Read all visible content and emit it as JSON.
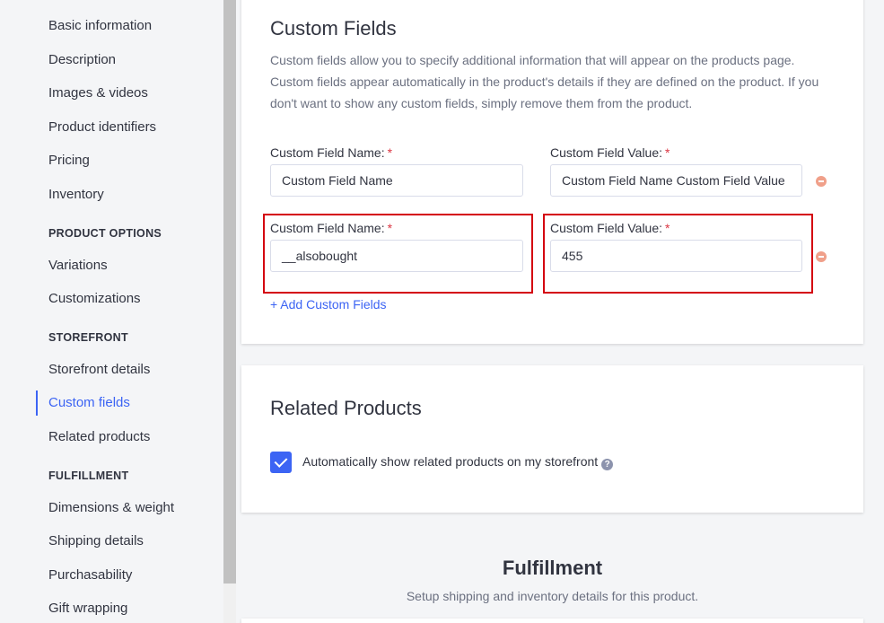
{
  "sidebar": {
    "items": [
      {
        "label": "Basic information"
      },
      {
        "label": "Description"
      },
      {
        "label": "Images & videos"
      },
      {
        "label": "Product identifiers"
      },
      {
        "label": "Pricing"
      },
      {
        "label": "Inventory"
      }
    ],
    "product_options": {
      "heading": "PRODUCT OPTIONS",
      "items": [
        {
          "label": "Variations"
        },
        {
          "label": "Customizations"
        }
      ]
    },
    "storefront": {
      "heading": "STOREFRONT",
      "items": [
        {
          "label": "Storefront details"
        },
        {
          "label": "Custom fields"
        },
        {
          "label": "Related products"
        }
      ]
    },
    "fulfillment": {
      "heading": "FULFILLMENT",
      "items": [
        {
          "label": "Dimensions & weight"
        },
        {
          "label": "Shipping details"
        },
        {
          "label": "Purchasability"
        },
        {
          "label": "Gift wrapping"
        }
      ]
    },
    "active_item": "Custom fields",
    "accent_color": "#3c64f4"
  },
  "custom_fields": {
    "title": "Custom Fields",
    "description": "Custom fields allow you to specify additional information that will appear on the products page. Custom fields appear automatically in the product's details if they are defined on the product. If you don't want to show any custom fields, simply remove them from the product.",
    "name_label": "Custom Field Name:",
    "value_label": "Custom Field Value:",
    "required_mark": "*",
    "rows": [
      {
        "name": "Custom Field Name",
        "value": "Custom Field Name Custom Field Value"
      },
      {
        "name": "__alsobought",
        "value": "455"
      }
    ],
    "add_link": "+ Add Custom Fields"
  },
  "related_products": {
    "title": "Related Products",
    "checkbox_label": "Automatically show related products on my storefront",
    "checked": true,
    "help_icon": "question-circle-icon"
  },
  "fulfillment": {
    "title": "Fulfillment",
    "subtitle": "Setup shipping and inventory details for this product."
  },
  "colors": {
    "highlight": "#d4000f",
    "remove": "#f0a08a"
  }
}
